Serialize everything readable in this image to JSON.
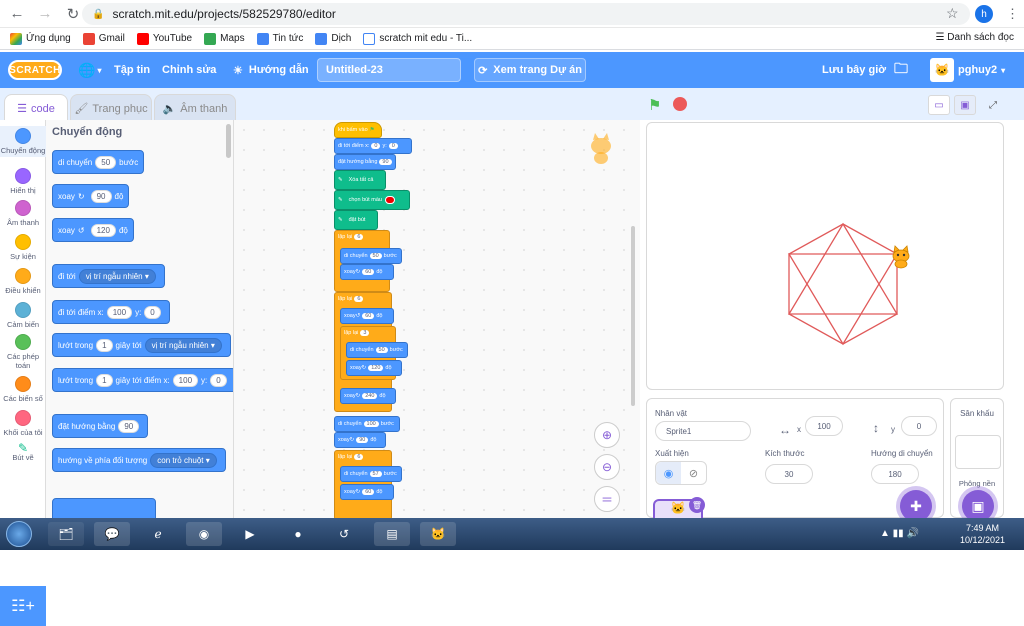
{
  "browser": {
    "url": "scratch.mit.edu/projects/582529780/editor",
    "profile_initial": "h",
    "bookmarks": [
      "Ứng dụng",
      "Gmail",
      "YouTube",
      "Maps",
      "Tin tức",
      "Dịch",
      "scratch mit edu - Ti..."
    ],
    "reading_list": "Danh sách đọc"
  },
  "menu": {
    "logo": "SCRATCH",
    "file": "Tập tin",
    "edit": "Chỉnh sửa",
    "tutorials": "Hướng dẫn",
    "project_title": "Untitled-23",
    "see_project": "Xem trang Dự án",
    "save_now": "Lưu bây giờ",
    "username": "pghuy2"
  },
  "tabs": {
    "code": "code",
    "costumes": "Trang phục",
    "sounds": "Âm thanh"
  },
  "categories": [
    {
      "label": "Chuyển động",
      "color": "#4c97ff"
    },
    {
      "label": "Hiển thị",
      "color": "#9966ff"
    },
    {
      "label": "Âm thanh",
      "color": "#cf63cf"
    },
    {
      "label": "Sự kiện",
      "color": "#ffbf00"
    },
    {
      "label": "Điều khiển",
      "color": "#ffab19"
    },
    {
      "label": "Cảm biến",
      "color": "#5cb1d6"
    },
    {
      "label": "Các phép toán",
      "color": "#59c059"
    },
    {
      "label": "Các biến số",
      "color": "#ff8c1a"
    },
    {
      "label": "Khối của tôi",
      "color": "#ff6680"
    },
    {
      "label": "Bút vẽ",
      "color": "#0fbd8c"
    }
  ],
  "palette": {
    "title": "Chuyển động",
    "blocks": {
      "move": {
        "pre": "di chuyển",
        "val": "50",
        "post": "bước"
      },
      "turn_right": {
        "pre": "xoay",
        "val": "90",
        "post": "độ"
      },
      "turn_left": {
        "pre": "xoay",
        "val": "120",
        "post": "độ"
      },
      "goto": {
        "pre": "đi tới",
        "dd": "vị trí ngẫu nhiên"
      },
      "goto_xy": {
        "pre": "đi tới điểm x:",
        "x": "100",
        "ylab": "y:",
        "y": "0"
      },
      "glide": {
        "pre": "lướt trong",
        "val": "1",
        "mid": "giây tới",
        "dd": "vị trí ngẫu nhiên"
      },
      "glide_xy": {
        "pre": "lướt trong",
        "val": "1",
        "mid": "giây tới điểm x:",
        "x": "100",
        "ylab": "y:",
        "y": "0"
      },
      "point_dir": {
        "pre": "đặt hướng bằng",
        "val": "90"
      },
      "point_towards": {
        "pre": "hướng về phía đối tượng",
        "dd": "con trỏ chuột"
      }
    }
  },
  "script": {
    "hat": "khi bấm vào",
    "goto": {
      "pre": "đi tới điểm x:",
      "x": "0",
      "ylab": "y:",
      "y": "0"
    },
    "point": {
      "pre": "đặt hướng bằng",
      "val": "90"
    },
    "clear": "Xóa tất cả",
    "pen_color": "chọn bút màu",
    "pen_down": "đặt bút",
    "repeat1": {
      "pre": "lặp lại",
      "val": "6"
    },
    "move1": {
      "pre": "di chuyển",
      "val": "50",
      "post": "bước"
    },
    "turn1": {
      "pre": "xoay",
      "val": "60",
      "post": "độ"
    },
    "repeat2": {
      "pre": "lặp lại",
      "val": "6"
    },
    "turn2": {
      "pre": "xoay",
      "val": "60",
      "post": "độ"
    },
    "repeat3": {
      "pre": "lặp lại",
      "val": "3"
    },
    "move2": {
      "pre": "di chuyển",
      "val": "50",
      "post": "bước"
    },
    "turn3": {
      "pre": "xoay",
      "val": "120",
      "post": "độ"
    },
    "turn4": {
      "pre": "xoay",
      "val": "240",
      "post": "độ"
    },
    "move3": {
      "pre": "di chuyển",
      "val": "100",
      "post": "bước"
    },
    "turn5": {
      "pre": "xoay",
      "val": "90",
      "post": "độ"
    },
    "repeat4": {
      "pre": "lặp lại",
      "val": "6"
    },
    "move4": {
      "pre": "di chuyển",
      "val": "57",
      "post": "bước"
    },
    "turn6": {
      "pre": "xoay",
      "val": "60",
      "post": "độ"
    }
  },
  "sprite_info": {
    "sprite_label": "Nhân vật",
    "sprite_name": "Sprite1",
    "x_label": "x",
    "x": "100",
    "y_label": "y",
    "y": "0",
    "show_label": "Xuất hiện",
    "size_label": "Kích thước",
    "size": "30",
    "direction_label": "Hướng di chuyển",
    "direction": "180"
  },
  "stage_pane": {
    "title": "Sân khấu",
    "backdrops_label": "Phông nền"
  },
  "taskbar": {
    "time": "7:49 AM",
    "date": "10/12/2021"
  },
  "colors": {
    "scratch_blue": "#4c97ff",
    "pen_line": "#e05a5a",
    "purple": "#855cd6"
  }
}
